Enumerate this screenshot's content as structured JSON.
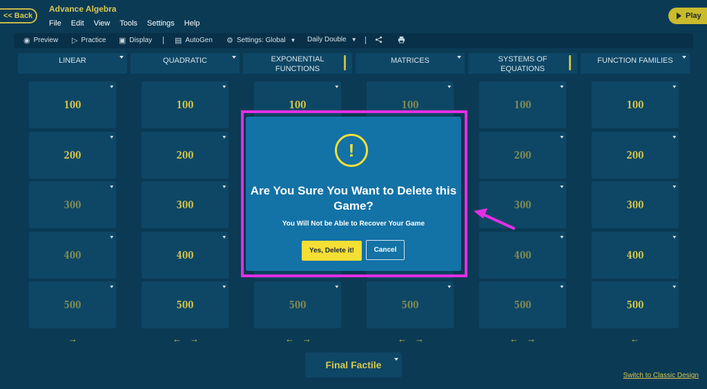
{
  "header": {
    "back_label": "<< Back",
    "app_title": "Advance Algebra",
    "menu": [
      "File",
      "Edit",
      "View",
      "Tools",
      "Settings",
      "Help"
    ],
    "play_label": "Play"
  },
  "toolbar": {
    "preview": "Preview",
    "practice": "Practice",
    "display": "Display",
    "autogen": "AutoGen",
    "settings": "Settings: Global",
    "daily_double": "Daily Double"
  },
  "board": {
    "categories": [
      "LINEAR",
      "QUADRATIC",
      "EXPONENTIAL\nFUNCTIONS",
      "MATRICES",
      "SYSTEMS OF\nEQUATIONS",
      "FUNCTION FAMILIES"
    ],
    "values": [
      "100",
      "200",
      "300",
      "400",
      "500"
    ]
  },
  "final": {
    "label": "Final Factile"
  },
  "footer": {
    "switch_link": "Switch to Classic Design"
  },
  "modal": {
    "icon_glyph": "!",
    "title": "Are You Sure You Want to Delete this Game?",
    "subtitle": "You Will Not be Able to Recover Your Game",
    "confirm_label": "Yes, Delete it!",
    "cancel_label": "Cancel"
  },
  "colors": {
    "background": "#0b3a55",
    "tile": "#0e4765",
    "accent_gold": "#d1c24a",
    "modal_blue": "#1372a6",
    "highlight_magenta": "#e42ee6",
    "confirm_yellow": "#f4df35"
  },
  "icons": {
    "preview": "eye-icon",
    "practice": "practice-icon",
    "display": "display-icon",
    "autogen": "autogen-icon",
    "settings": "gear-icon",
    "share": "share-icon",
    "print": "print-icon",
    "warning": "warning-icon"
  }
}
